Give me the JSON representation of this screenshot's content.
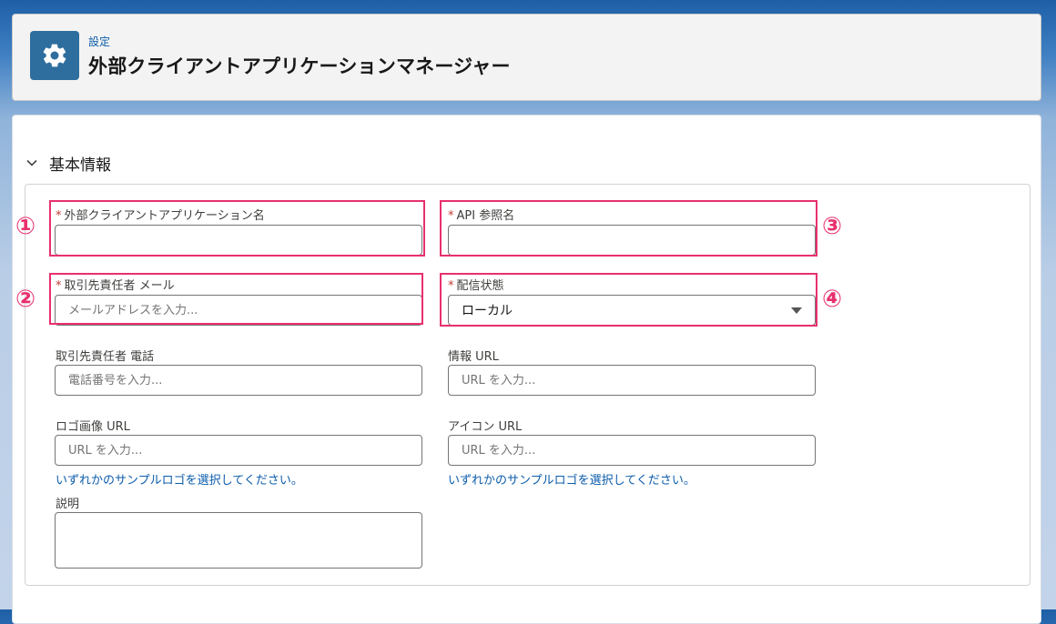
{
  "header": {
    "breadcrumb": "設定",
    "title": "外部クライアントアプリケーションマネージャー",
    "icon": "gear-icon"
  },
  "section": {
    "title": "基本情報",
    "icon": "chevron-down-icon"
  },
  "form": {
    "app_name": {
      "label": "外部クライアントアプリケーション名",
      "required": "*",
      "value": "",
      "placeholder": ""
    },
    "api_name": {
      "label": "API 参照名",
      "required": "*",
      "value": "",
      "placeholder": ""
    },
    "contact_email": {
      "label": "取引先責任者 メール",
      "required": "*",
      "value": "",
      "placeholder": "メールアドレスを入力..."
    },
    "distribution_state": {
      "label": "配信状態",
      "required": "*",
      "value": "ローカル",
      "icon": "caret-down-icon"
    },
    "contact_phone": {
      "label": "取引先責任者 電話",
      "value": "",
      "placeholder": "電話番号を入力..."
    },
    "info_url": {
      "label": "情報 URL",
      "value": "",
      "placeholder": "URL を入力..."
    },
    "logo_url": {
      "label": "ロゴ画像 URL",
      "value": "",
      "placeholder": "URL を入力...",
      "link": "いずれかのサンプルロゴを選択してください。"
    },
    "icon_url": {
      "label": "アイコン URL",
      "value": "",
      "placeholder": "URL を入力...",
      "link": "いずれかのサンプルロゴを選択してください。"
    },
    "description": {
      "label": "説明",
      "value": ""
    }
  },
  "annotations": {
    "marker_1": "①",
    "marker_2": "②",
    "marker_3": "③",
    "marker_4": "④",
    "color": "#e8306e"
  },
  "colors": {
    "brand_icon_bg": "#2e6e9e",
    "link": "#0b5cab",
    "required": "#c23934"
  }
}
